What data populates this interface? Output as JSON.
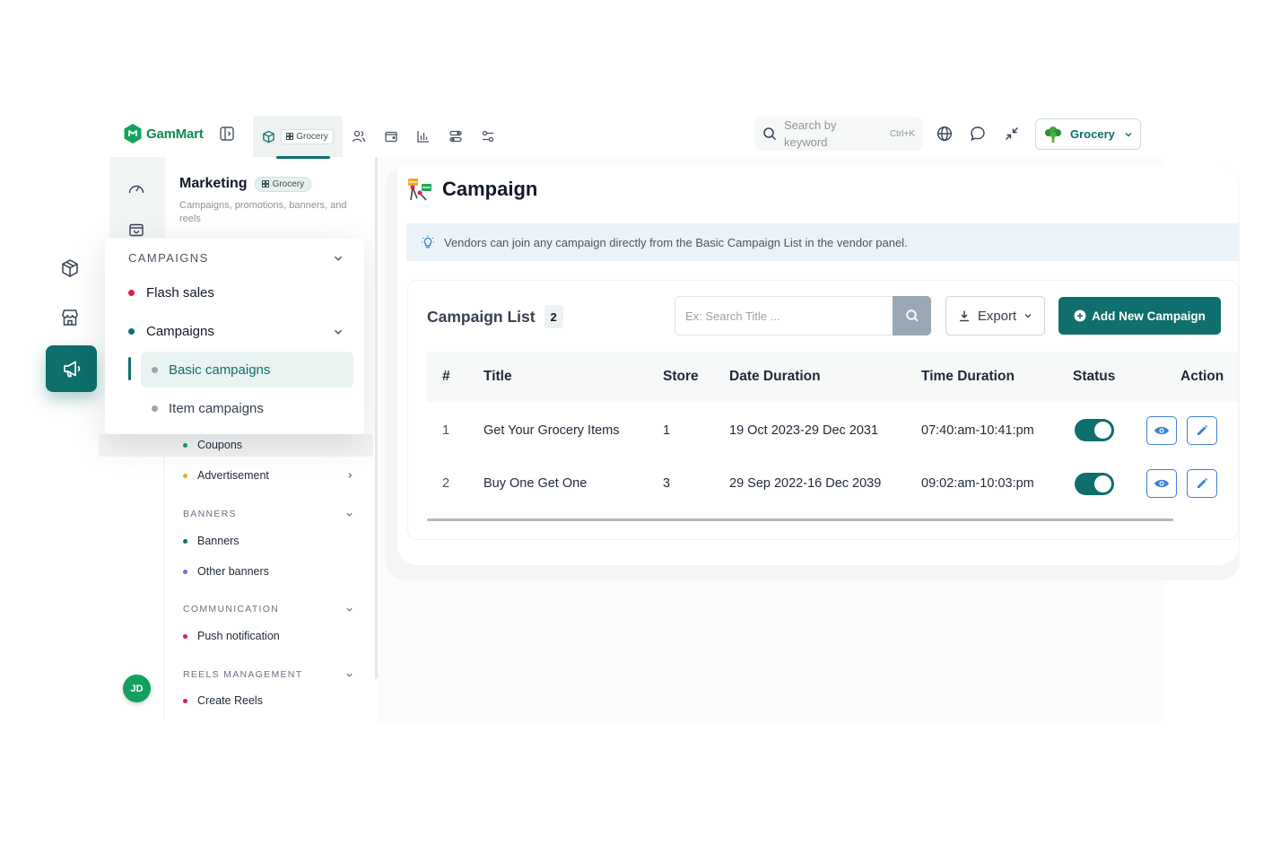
{
  "brand": {
    "name": "GamMart"
  },
  "top_nav": {
    "active_tab_badge": "Grocery",
    "search": {
      "placeholder": "Search by keyword",
      "shortcut": "Ctrl+K"
    },
    "store_select": {
      "label": "Grocery"
    }
  },
  "section": {
    "title": "Marketing",
    "badge": "Grocery",
    "description": "Campaigns, promotions, banners, and reels"
  },
  "menu": {
    "campaigns_header": "CAMPAIGNS",
    "flash_sales": "Flash sales",
    "campaigns": "Campaigns",
    "basic_campaigns": "Basic campaigns",
    "item_campaigns": "Item campaigns",
    "coupons": "Coupons",
    "advertisement": "Advertisement",
    "banners_header": "BANNERS",
    "banners": "Banners",
    "other_banners": "Other banners",
    "communication_header": "COMMUNICATION",
    "push_notification": "Push notification",
    "reels_header": "REELS MANAGEMENT",
    "create_reels": "Create Reels"
  },
  "user": {
    "initials": "JD"
  },
  "page": {
    "title": "Campaign",
    "info": "Vendors can join any campaign directly from the Basic Campaign List in the vendor panel."
  },
  "campaign_list": {
    "title": "Campaign List",
    "count": "2",
    "search_placeholder": "Ex: Search Title ...",
    "export_label": "Export",
    "add_label": "Add New Campaign",
    "columns": [
      "#",
      "Title",
      "Store",
      "Date Duration",
      "Time Duration",
      "Status",
      "Action"
    ],
    "rows": [
      {
        "index": "1",
        "title": "Get Your Grocery Items",
        "store": "1",
        "date": "19 Oct 2023-29 Dec 2031",
        "time": "07:40:am-10:41:pm",
        "status": "on"
      },
      {
        "index": "2",
        "title": "Buy One Get One",
        "store": "3",
        "date": "29 Sep 2022-16 Dec 2039",
        "time": "09:02:am-10:03:pm",
        "status": "on"
      }
    ]
  },
  "colors": {
    "primary": "#0e6f6c",
    "brand_green": "#0e8a52",
    "action_blue": "#3f7fd9",
    "info_bg": "#ebf3f9"
  }
}
